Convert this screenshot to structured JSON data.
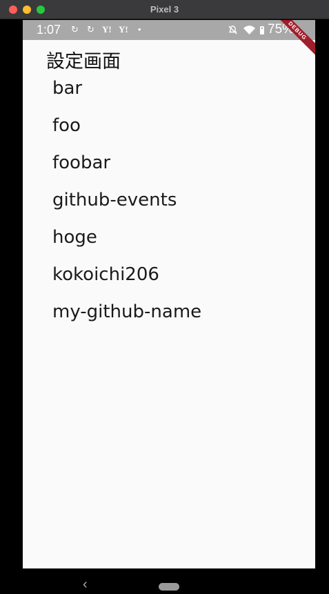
{
  "window": {
    "title": "Pixel 3"
  },
  "status_bar": {
    "time": "1:07",
    "notification_icons": [
      "sync-icon",
      "sync-icon",
      "yahoo-icon",
      "yahoo-icon",
      "dot-icon"
    ],
    "notification_glyphs": [
      "↻",
      "↻",
      "Y!",
      "Y!",
      "•"
    ],
    "battery": "75%"
  },
  "debug_banner": "DEBUG",
  "page": {
    "title": "設定画面",
    "items": [
      {
        "label": "bar"
      },
      {
        "label": "foo"
      },
      {
        "label": "foobar"
      },
      {
        "label": "github-events"
      },
      {
        "label": "hoge"
      },
      {
        "label": "kokoichi206"
      },
      {
        "label": "my-github-name"
      }
    ]
  },
  "nav": {
    "back_glyph": "‹"
  }
}
